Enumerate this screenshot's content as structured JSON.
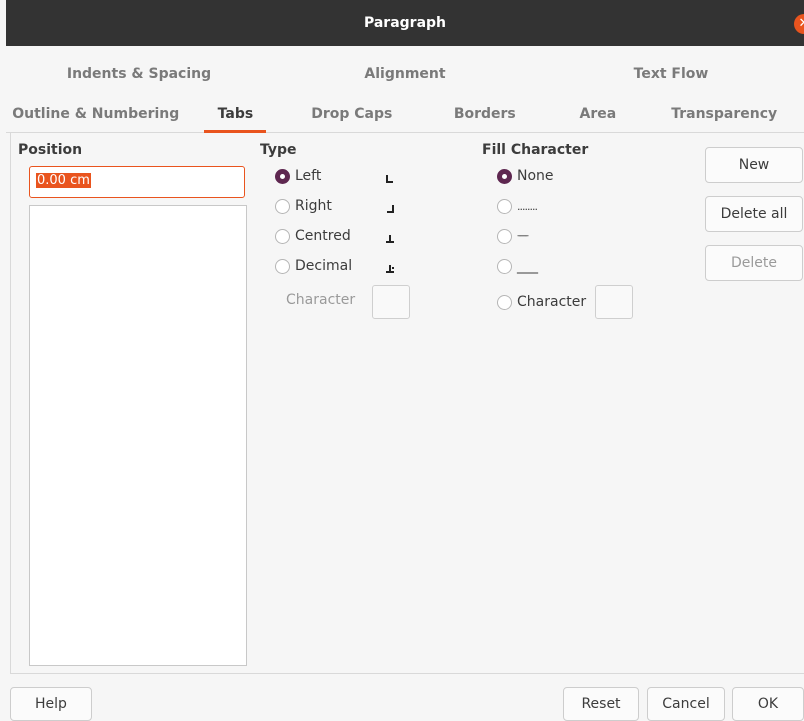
{
  "dialog": {
    "title": "Paragraph"
  },
  "tabs_row1": [
    "Indents & Spacing",
    "Alignment",
    "Text Flow"
  ],
  "tabs_row2": [
    "Outline & Numbering",
    "Tabs",
    "Drop Caps",
    "Borders",
    "Area",
    "Transparency"
  ],
  "active_tab": "Tabs",
  "position": {
    "heading": "Position",
    "value": "0.00 cm"
  },
  "type": {
    "heading": "Type",
    "options": [
      "Left",
      "Right",
      "Centred",
      "Decimal"
    ],
    "selected": "Left",
    "character_label": "Character"
  },
  "fill": {
    "heading": "Fill Character",
    "none_label": "None",
    "dots": "........",
    "dashes": "--------",
    "underline": "___",
    "character_label": "Character",
    "selected": "None"
  },
  "side_buttons": {
    "new": "New",
    "delete_all": "Delete all",
    "delete": "Delete"
  },
  "footer": {
    "help": "Help",
    "reset": "Reset",
    "cancel": "Cancel",
    "ok": "OK"
  },
  "colors": {
    "accent": "#e9541e",
    "radio_selected": "#5e2750",
    "titlebar": "#333333"
  }
}
